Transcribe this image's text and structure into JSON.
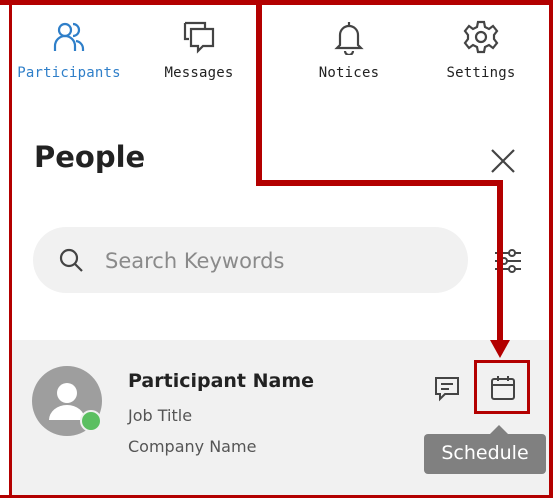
{
  "tabs": [
    {
      "label": "Participants",
      "icon": "participants-icon",
      "active": true
    },
    {
      "label": "Messages",
      "icon": "messages-icon",
      "active": false
    },
    {
      "label": "Notices",
      "icon": "bell-icon",
      "active": false
    },
    {
      "label": "Settings",
      "icon": "gear-icon",
      "active": false
    }
  ],
  "panel": {
    "title": "People",
    "close_icon": "close-icon"
  },
  "search": {
    "placeholder": "Search Keywords",
    "value": "",
    "icon": "search-icon",
    "filter_icon": "filter-icon"
  },
  "participant": {
    "name": "Participant Name",
    "job_title": "Job Title",
    "company": "Company Name",
    "status": "online",
    "message_icon": "message-icon",
    "schedule_icon": "calendar-icon"
  },
  "tooltip": {
    "label": "Schedule"
  },
  "colors": {
    "accent": "#2f7fc9",
    "annotation": "#b30000",
    "row_background": "#f1f1f1",
    "online": "#5bbf61",
    "tooltip_background": "#808080"
  }
}
